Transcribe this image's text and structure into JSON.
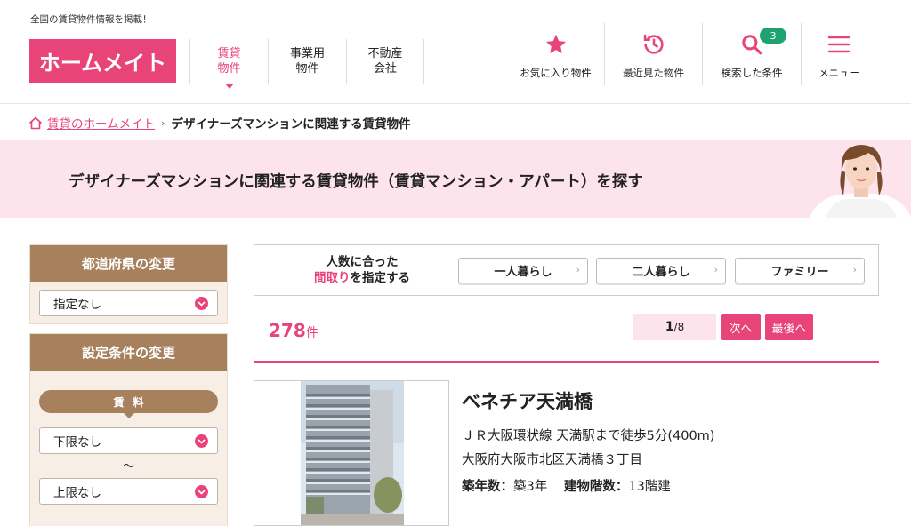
{
  "header": {
    "tagline": "全国の賃貸物件情報を掲載！",
    "logo": "ホームメイト",
    "nav": [
      {
        "line1": "賃貸",
        "line2": "物件"
      },
      {
        "line1": "事業用",
        "line2": "物件"
      },
      {
        "line1": "不動産",
        "line2": "会社"
      }
    ],
    "utilities": [
      {
        "label": "お気に入り物件",
        "icon": "star-icon"
      },
      {
        "label": "最近見た物件",
        "icon": "history-icon"
      },
      {
        "label": "検索した条件",
        "icon": "search-icon",
        "badge": "3"
      },
      {
        "label": "メニュー",
        "icon": "menu-icon"
      }
    ]
  },
  "breadcrumb": {
    "home": "賃貸のホームメイト",
    "separator": "›",
    "current": "デザイナーズマンションに関連する賃貸物件"
  },
  "banner": {
    "title": "デザイナーズマンションに関連する賃貸物件（賃貸マンション・アパート）を探す"
  },
  "sidebar": {
    "prefecture": {
      "title": "都道府県の変更",
      "value": "指定なし"
    },
    "conditions": {
      "title": "設定条件の変更",
      "rent_label": "賃料",
      "min": "下限なし",
      "tilde": "～",
      "max": "上限なし"
    }
  },
  "layout_filter": {
    "label_line1": "人数に合った",
    "label_pink": "間取り",
    "label_rest": "を指定する",
    "buttons": [
      "一人暮らし",
      "二人暮らし",
      "ファミリー"
    ],
    "chevron": "›"
  },
  "results": {
    "count": "278",
    "unit": "件",
    "current_page": "1",
    "total_pages": "/8",
    "next": "次へ",
    "last": "最後へ"
  },
  "property": {
    "name": "ベネチア天満橋",
    "access": "ＪＲ大阪環状線 天満駅まで徒歩5分(400m)",
    "address": "大阪府大阪市北区天満橋３丁目",
    "age_label": "築年数：",
    "age_value": "築3年",
    "floors_label": "建物階数：",
    "floors_value": "13階建"
  },
  "colors": {
    "brand": "#e8447a",
    "sidebar": "#a7815d",
    "badge": "#1ea370"
  }
}
